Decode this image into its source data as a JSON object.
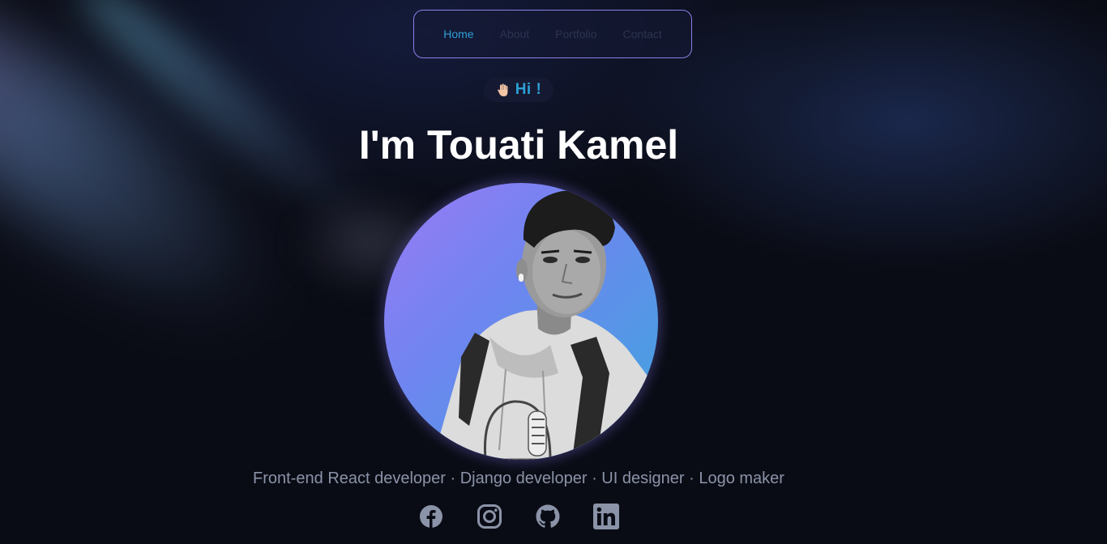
{
  "nav": {
    "items": [
      {
        "label": "Home",
        "active": true
      },
      {
        "label": "About",
        "active": false
      },
      {
        "label": "Portfolio",
        "active": false
      },
      {
        "label": "Contact",
        "active": false
      }
    ]
  },
  "hero": {
    "greeting": "Hi !",
    "greeting_icon": "waving-hand-icon",
    "title": "I'm Touati Kamel",
    "subtitle": "Front-end React developer · Django developer · UI designer · Logo maker"
  },
  "socials": [
    {
      "name": "facebook-icon"
    },
    {
      "name": "instagram-icon"
    },
    {
      "name": "github-icon"
    },
    {
      "name": "linkedin-icon"
    }
  ],
  "colors": {
    "accent": "#2d9fd6",
    "nav_border": "#8c7fe8",
    "background": "#0a0c15",
    "social_icon": "#8b93a8"
  }
}
